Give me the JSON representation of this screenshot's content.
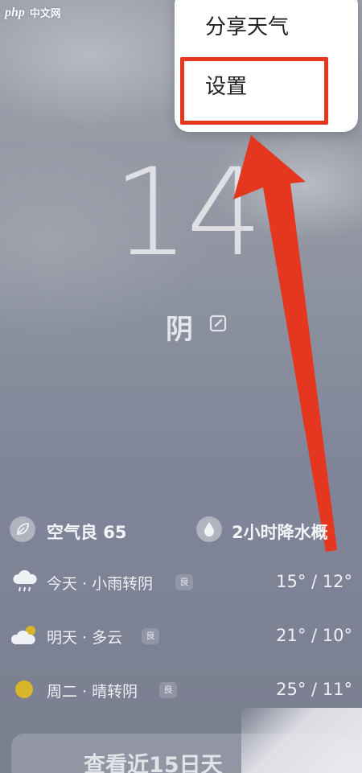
{
  "watermark": {
    "brand": "php",
    "site": "中文网"
  },
  "menu": {
    "items": [
      {
        "label": "分享天气"
      },
      {
        "label": "设置"
      }
    ]
  },
  "current": {
    "temperature": "14",
    "condition": "阴"
  },
  "summary": {
    "air_quality": "空气良 65",
    "precip": "2小时降水概"
  },
  "forecast": [
    {
      "label": "今天 · 小雨转阴",
      "badge": "良",
      "temps": "15° / 12°",
      "icon": "rain-cloud-icon"
    },
    {
      "label": "明天 · 多云",
      "badge": "良",
      "temps": "21° / 10°",
      "icon": "partly-cloudy-icon"
    },
    {
      "label": "周二 · 晴转阴",
      "badge": "良",
      "temps": "25° / 11°",
      "icon": "sun-icon"
    }
  ],
  "bottom": {
    "label": "查看近15日天"
  },
  "colors": {
    "accent_red": "#e5361f",
    "sun": "#d8b62a"
  }
}
